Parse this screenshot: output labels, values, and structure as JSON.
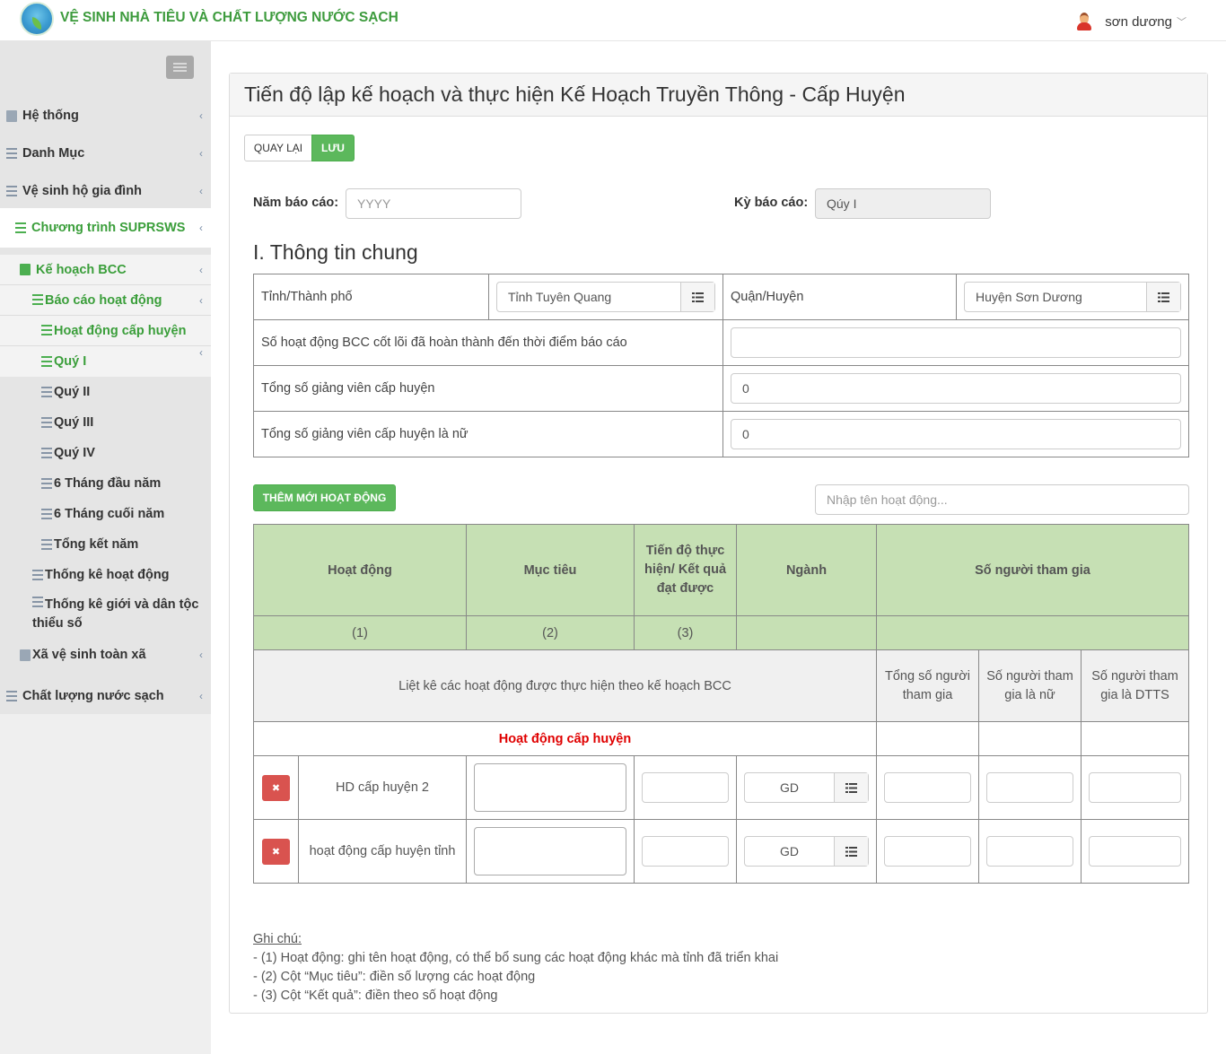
{
  "header": {
    "brand": "VỆ SINH NHÀ TIÊU VÀ CHẤT LƯỢNG NƯỚC SẠCH",
    "user_name": "sơn dương"
  },
  "sidebar": {
    "items": [
      {
        "label": "Hệ thống"
      },
      {
        "label": "Danh Mục"
      },
      {
        "label": "Vệ sinh hộ gia đình"
      },
      {
        "label": "Chương trình SUPRSWS"
      },
      {
        "label": "Kế hoạch BCC"
      },
      {
        "label": "Báo cáo hoạt động"
      },
      {
        "label": "Hoạt động cấp huyện"
      },
      {
        "label": "Quý I"
      },
      {
        "label": "Quý II"
      },
      {
        "label": "Quý III"
      },
      {
        "label": "Quý IV"
      },
      {
        "label": "6 Tháng đầu năm"
      },
      {
        "label": "6 Tháng cuối năm"
      },
      {
        "label": "Tổng kết năm"
      },
      {
        "label": "Thống kê hoạt động"
      },
      {
        "label": "Thống kê giới và dân tộc thiểu số"
      },
      {
        "label": "Xã vệ sinh toàn xã"
      },
      {
        "label": "Chất lượng nước sạch"
      }
    ]
  },
  "page": {
    "title": "Tiến độ lập kế hoạch và thực hiện Kế Hoạch Truyền Thông - Cấp Huyện",
    "back_label": "QUAY LẠI",
    "save_label": "LƯU",
    "year_label": "Năm báo cáo:",
    "year_placeholder": "YYYY",
    "period_label": "Kỳ báo cáo:",
    "period_value": "Qúy I",
    "section_title": "I. Thông tin chung"
  },
  "info": {
    "province_label": "Tỉnh/Thành phố",
    "province_value": "Tỉnh Tuyên Quang",
    "district_label": "Quận/Huyện",
    "district_value": "Huyện Sơn Dương",
    "rows": [
      {
        "label": "Số hoạt động BCC cốt lõi đã hoàn thành đến thời điểm báo cáo",
        "value": ""
      },
      {
        "label": "Tổng số giảng viên cấp huyện",
        "value": "0"
      },
      {
        "label": "Tổng số giảng viên cấp huyện là nữ",
        "value": "0"
      }
    ]
  },
  "activities": {
    "add_label": "THÊM MỚI HOẠT ĐỘNG",
    "search_placeholder": "Nhập tên hoạt động...",
    "headers": {
      "activity": "Hoạt động",
      "target": "Mục tiêu",
      "progress": "Tiến độ thực hiện/ Kết quả đạt được",
      "sector": "Ngành",
      "participants": "Số người tham gia"
    },
    "col_numbers": [
      "(1)",
      "(2)",
      "(3)"
    ],
    "list_label": "Liệt kê các hoạt động được thực hiện theo kế hoạch BCC",
    "sub_headers": [
      "Tổng số người tham gia",
      "Số người tham gia là nữ",
      "Số người tham gia là DTTS"
    ],
    "group_label": "Hoạt động cấp huyện",
    "rows": [
      {
        "name": "HD cấp huyện 2",
        "sector": "GD"
      },
      {
        "name": "hoạt động cấp huyện tỉnh",
        "sector": "GD"
      }
    ],
    "delete_symbol": "✖"
  },
  "notes": {
    "title": "Ghi chú:",
    "lines": [
      "- (1) Hoạt động: ghi tên hoạt động, có thể bổ sung các hoạt động khác mà tỉnh đã triển khai",
      "- (2) Cột “Mục tiêu”: điền số lượng các hoạt động",
      "- (3) Cột “Kết quả”: điền theo số hoạt động"
    ]
  },
  "colors": {
    "brand_green": "#3d9b3d",
    "button_green": "#5cb85c",
    "header_green": "#c6e0b4",
    "danger": "#d9534f"
  }
}
